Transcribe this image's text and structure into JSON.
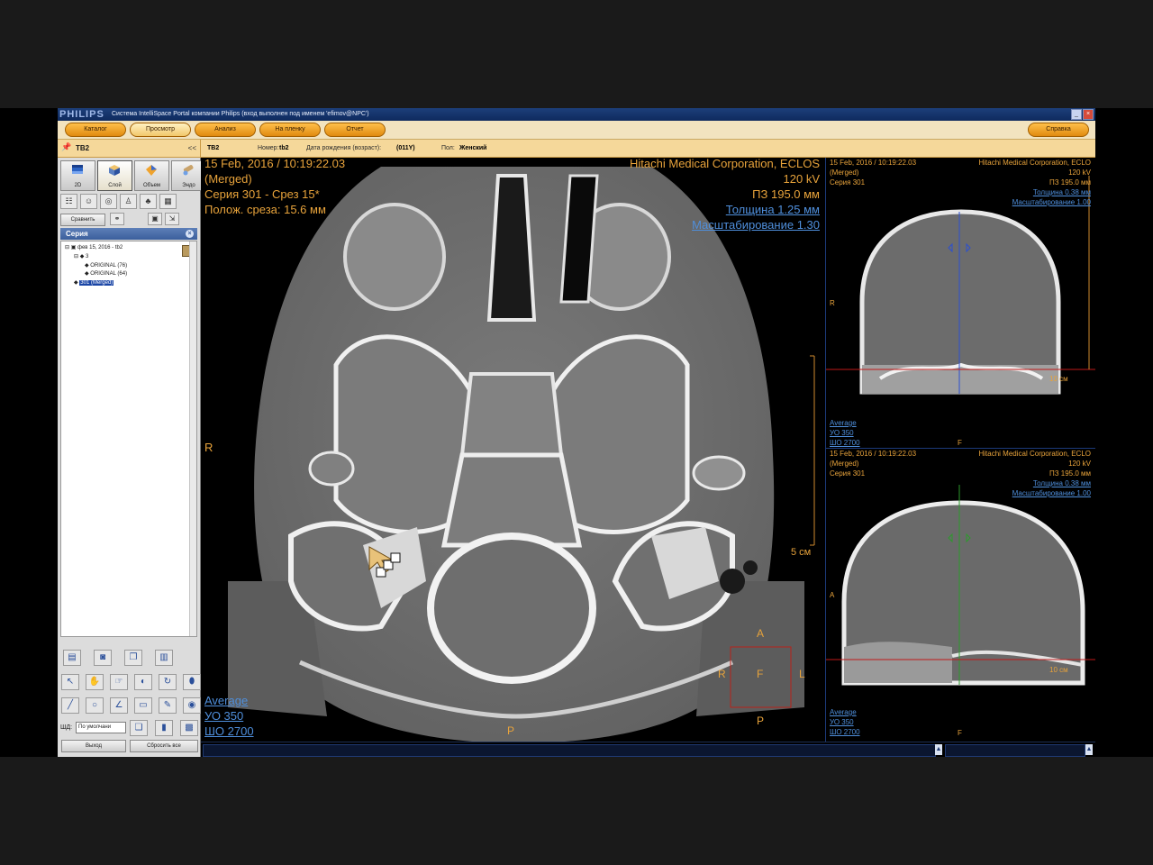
{
  "window": {
    "logo": "PHILIPS",
    "title": "Система IntelliSpace Portal компании Philips (вход выполнен под именем 'efimov@NPC')"
  },
  "nav": {
    "catalog": "Каталог",
    "view": "Просмотр",
    "analysis": "Анализ",
    "to_film": "На пленку",
    "report": "Отчет",
    "help": "Справка"
  },
  "patient": {
    "panel_title": "ТВ2",
    "collapse": "<<",
    "name": "ТВ2",
    "number_label": "Номер:",
    "number": "tb2",
    "dob_label": "Дата рождения (возраст):",
    "dob": "(011Y)",
    "sex_label": "Пол:",
    "sex": "Женский"
  },
  "modes": [
    {
      "label": "2D",
      "icon": "2d-mode-icon"
    },
    {
      "label": "Слой",
      "icon": "slab-mode-icon"
    },
    {
      "label": "Объем",
      "icon": "volume-mode-icon"
    },
    {
      "label": "Эндо",
      "icon": "endo-mode-icon"
    }
  ],
  "compare_button": "Сравнить",
  "series_panel": {
    "title": "Серия",
    "items": [
      {
        "label": "фев 15, 2016 - tb2"
      },
      {
        "label": "3"
      },
      {
        "label": "ORIGINAL (76)"
      },
      {
        "label": "ORIGINAL (64)"
      },
      {
        "label": "301 (Merged)"
      }
    ]
  },
  "window_level": {
    "label": "ШД:",
    "value": "По умолчани"
  },
  "bottom_buttons": {
    "exit": "Выход",
    "reset_all": "Сбросить все"
  },
  "main_view": {
    "date_time": "15 Feb, 2016 / 10:19:22.03",
    "merged": "(Merged)",
    "series_slice": "Серия 301 - Срез 15*",
    "slice_pos": "Полож. среза: 15.6 мм",
    "manufacturer": "Hitachi Medical Corporation, ECLOS",
    "kv": "120 kV",
    "fov": "ПЗ 195.0 мм",
    "thickness": "Толщина 1.25 мм",
    "scaling": "Масштабирование 1.30",
    "orient_left": "R",
    "scale_label": "5 см",
    "orient_bottom": "P",
    "window_preset": "Average",
    "wl_center": "УО   350",
    "wl_width": "ШО  2700",
    "cube": {
      "top": "A",
      "left": "R",
      "center": "F",
      "right": "L",
      "bottom": "P"
    }
  },
  "side_view_top": {
    "date_time": "15 Feb, 2016 / 10:19:22.03",
    "merged": "(Merged)",
    "series": "Серия 301",
    "manufacturer": "Hitachi Medical Corporation, ECLO",
    "kv": "120 kV",
    "fov": "ПЗ 195.0 мм",
    "thickness": "Толщина 0.38 мм",
    "scaling": "Масштабирование 1.00",
    "orient_left": "R",
    "scale_label": "10 см",
    "orient_bottom": "F",
    "window_preset": "Average",
    "wl_center": "УО   350",
    "wl_width": "ШО  2700"
  },
  "side_view_bottom": {
    "date_time": "15 Feb, 2016 / 10:19:22.03",
    "merged": "(Merged)",
    "series": "Серия 301",
    "manufacturer": "Hitachi Medical Corporation, ECLO",
    "kv": "120 kV",
    "fov": "ПЗ 195.0 мм",
    "thickness": "Толщина 0.38 мм",
    "scaling": "Масштабирование 1.00",
    "orient_left": "A",
    "scale_label": "10 см",
    "orient_bottom": "F",
    "window_preset": "Average",
    "wl_center": "УО   350",
    "wl_width": "ШО  2700"
  },
  "colors": {
    "overlay_text": "#e8a33b",
    "overlay_link": "#4f8fdc",
    "nav_button": "#f3a531",
    "title_bar": "#15326b"
  }
}
